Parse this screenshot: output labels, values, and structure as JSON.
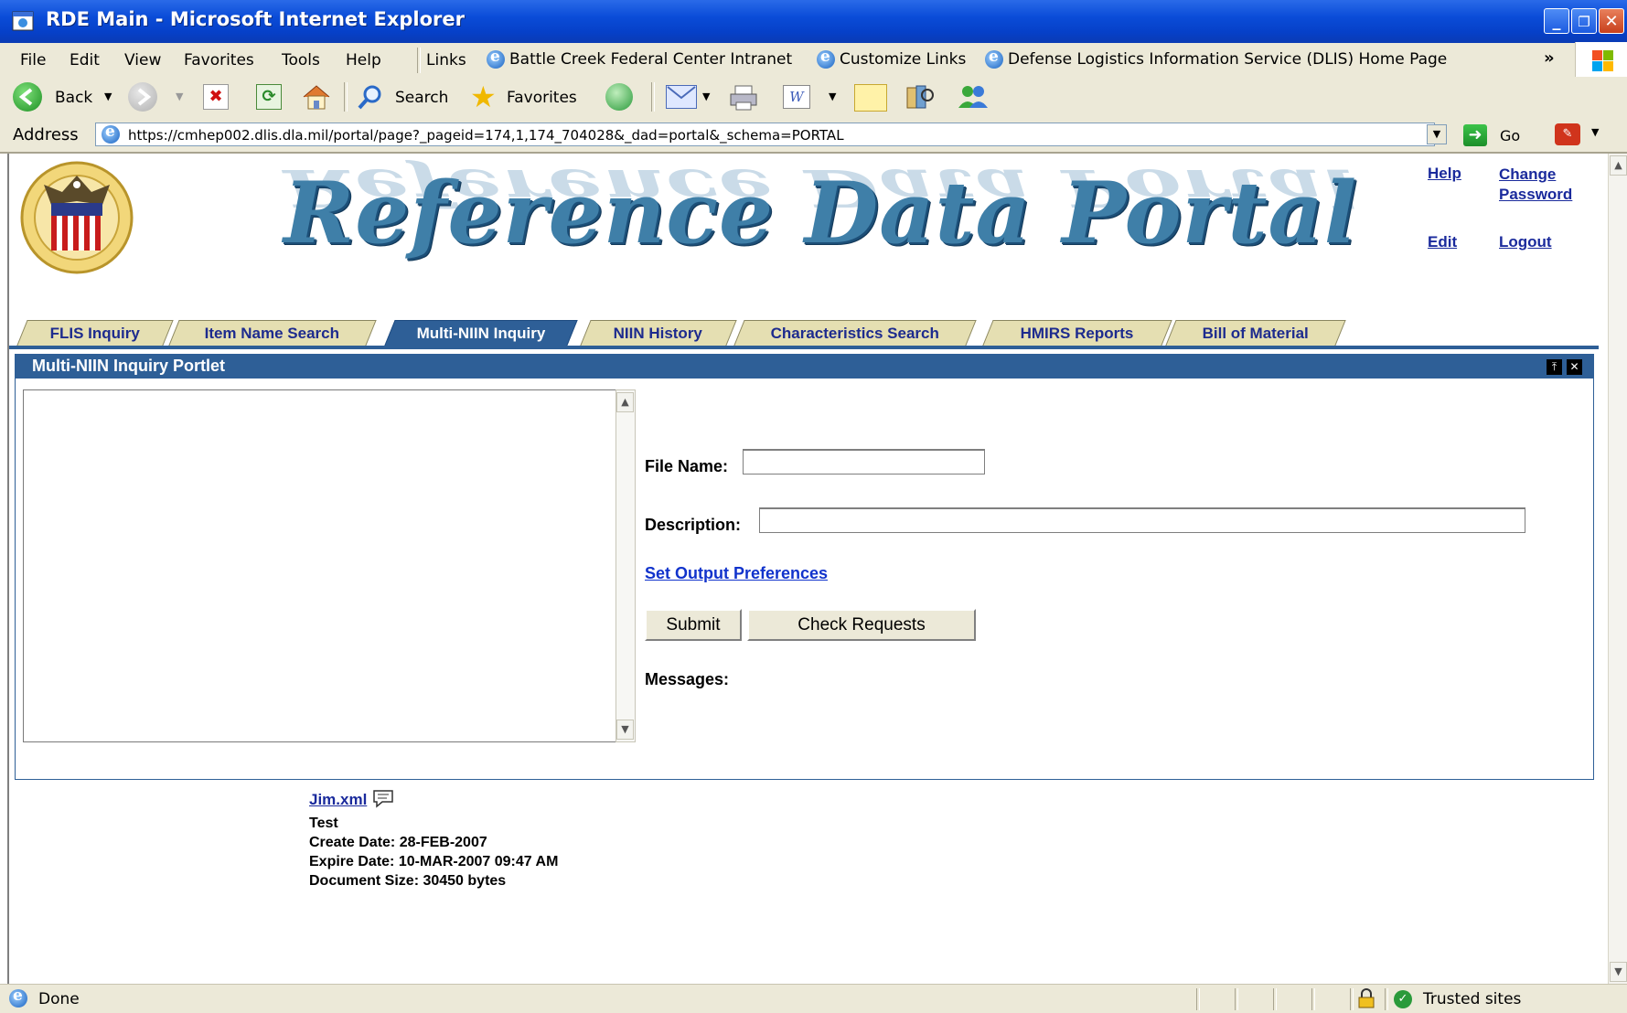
{
  "window": {
    "title": "RDE Main - Microsoft Internet Explorer"
  },
  "menu": {
    "items": [
      "File",
      "Edit",
      "View",
      "Favorites",
      "Tools",
      "Help"
    ],
    "links_label": "Links",
    "links": [
      "Battle Creek Federal Center Intranet",
      "Customize Links",
      "Defense Logistics Information Service (DLIS) Home Page"
    ],
    "overflow": "»"
  },
  "toolbar": {
    "back": "Back",
    "search": "Search",
    "favorites": "Favorites"
  },
  "address": {
    "label": "Address",
    "url": "https://cmhep002.dlis.dla.mil/portal/page?_pageid=174,1,174_704028&_dad=portal&_schema=PORTAL",
    "go": "Go"
  },
  "banner": {
    "title": "Reference Data Portal",
    "links": {
      "help": "Help",
      "change_password": "Change Password",
      "edit": "Edit",
      "logout": "Logout"
    }
  },
  "tabs": [
    "FLIS Inquiry",
    "Item Name Search",
    "Multi-NIIN Inquiry",
    "NIIN History",
    "Characteristics Search",
    "HMIRS Reports",
    "Bill of Material"
  ],
  "active_tab": "Multi-NIIN Inquiry",
  "portlet": {
    "title": "Multi-NIIN Inquiry Portlet",
    "file_name_label": "File Name:",
    "file_name_value": "",
    "description_label": "Description:",
    "description_value": "",
    "output_prefs_link": "Set Output Preferences",
    "submit": "Submit",
    "check_requests": "Check Requests",
    "messages_label": "Messages:"
  },
  "document": {
    "file": "Jim.xml",
    "description": "Test",
    "create_date": "Create Date: 28-FEB-2007",
    "expire_date": "Expire Date: 10-MAR-2007 09:47 AM",
    "size": "Document Size: 30450 bytes"
  },
  "status": {
    "text": "Done",
    "zone": "Trusted sites"
  },
  "colors": {
    "title_bar": "#0a4cd8",
    "chrome": "#ece9d8",
    "tab_active": "#2e5f97",
    "tab_inactive": "#e5dfb2",
    "link": "#1a2a9c"
  }
}
